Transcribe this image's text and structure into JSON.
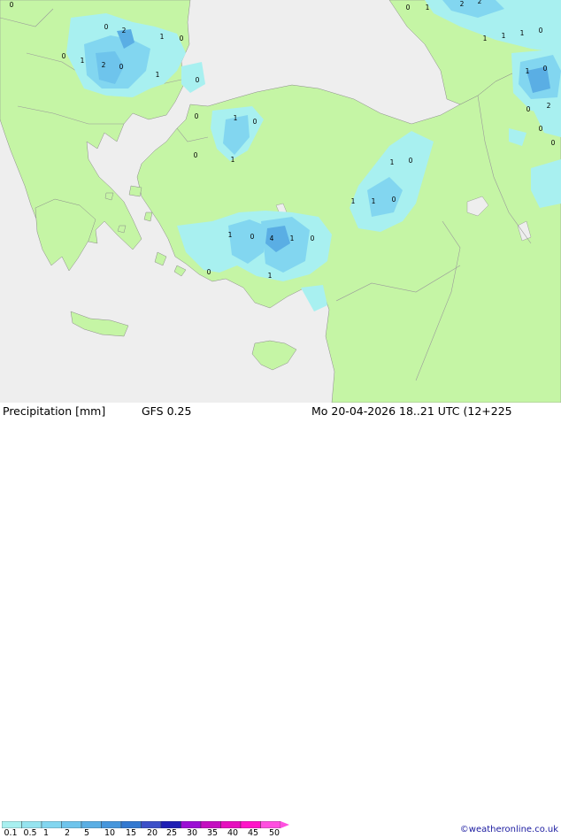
{
  "footer": {
    "product_label": "Precipitation [mm]",
    "model_label": "GFS 0.25",
    "valid_time": "Mo 20-04-2026 18..21 UTC (12+225",
    "credit": "©weatheronline.co.uk"
  },
  "legend": {
    "ticks": [
      "0.1",
      "0.5",
      "1",
      "2",
      "5",
      "10",
      "15",
      "20",
      "25",
      "30",
      "35",
      "40",
      "45",
      "50"
    ],
    "colors": [
      "#a8f0f0",
      "#96e4f0",
      "#82d6f0",
      "#6ec4ec",
      "#5aaee4",
      "#4696dc",
      "#3278d0",
      "#3c50c8",
      "#1e1eb4",
      "#9b0fd4",
      "#c40fc0",
      "#e60fbe",
      "#ff14c8",
      "#ff50e0"
    ]
  },
  "map": {
    "colors": {
      "sea": "#eeeeee",
      "land": "#c5f5a5",
      "border": "#8a8a8a",
      "precip_light": "#a8f0f0",
      "precip_mid": "#82d6f0",
      "precip_heavy": "#5aaee4"
    },
    "value_labels": [
      "0",
      "2",
      "1",
      "0",
      "0",
      "1",
      "2",
      "0",
      "1",
      "0",
      "0",
      "2",
      "2",
      "1",
      "0",
      "1",
      "1",
      "1",
      "0",
      "1",
      "0",
      "2",
      "0",
      "0",
      "0",
      "0",
      "1",
      "0",
      "1",
      "0",
      "1",
      "0",
      "1",
      "1",
      "0",
      "1",
      "0",
      "4",
      "1",
      "0",
      "0",
      "1"
    ]
  }
}
